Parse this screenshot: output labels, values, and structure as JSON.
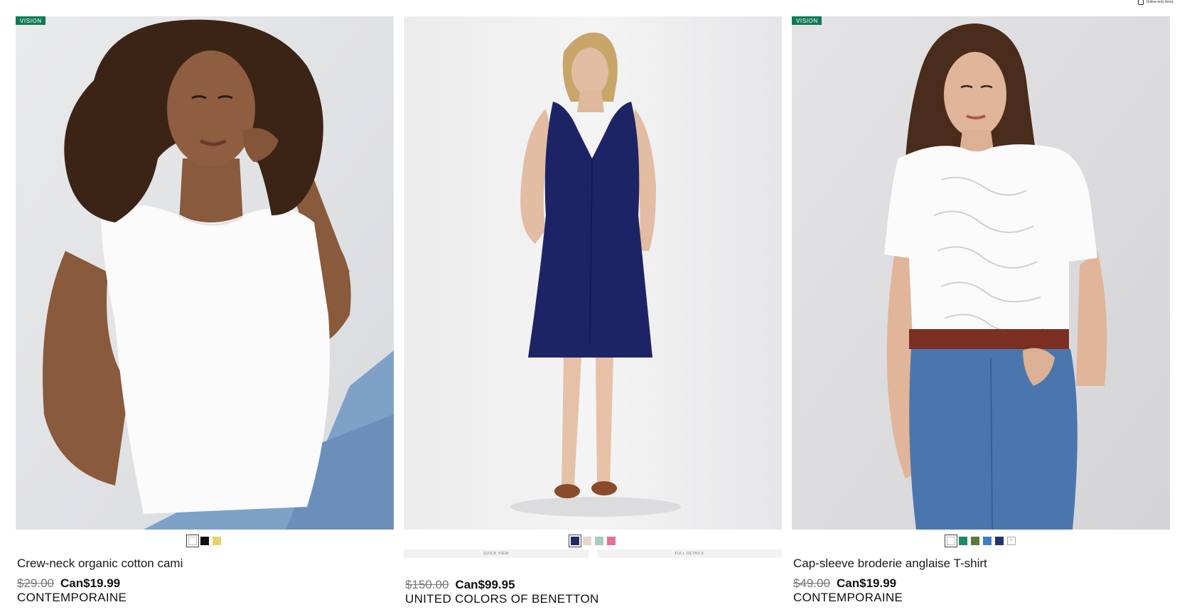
{
  "filter": {
    "online_only_label": "Online-only items"
  },
  "products": [
    {
      "badge": "VISION",
      "name": "Crew-neck organic cotton cami",
      "old_price": "$29.00",
      "price": "Can$19.99",
      "brand": "CONTEMPORAINE",
      "swatches": [
        "#ffffff",
        "#111111",
        "#e8d36a"
      ],
      "selected_swatch": 0,
      "photo_alt": "model-white-cami"
    },
    {
      "badge": "",
      "name": "",
      "old_price": "$150.00",
      "price": "Can$99.95",
      "brand": "UNITED COLORS OF BENETTON",
      "swatches": [
        "#1e2a66",
        "#e3d7cd",
        "#a9cbbf",
        "#e56f96"
      ],
      "selected_swatch": 0,
      "quick_view": "QUICK VIEW",
      "full_details": "FULL DETAILS",
      "photo_alt": "model-navy-dress"
    },
    {
      "badge": "VISION",
      "name": "Cap-sleeve broderie anglaise T-shirt",
      "old_price": "$49.00",
      "price": "Can$19.99",
      "brand": "CONTEMPORAINE",
      "swatches": [
        "#ffffff",
        "#1c8a6a",
        "#5e7a3a",
        "#3f7ec2",
        "#23356f"
      ],
      "more_swatches": "+",
      "selected_swatch": 0,
      "photo_alt": "model-white-eyelet-tee"
    }
  ]
}
